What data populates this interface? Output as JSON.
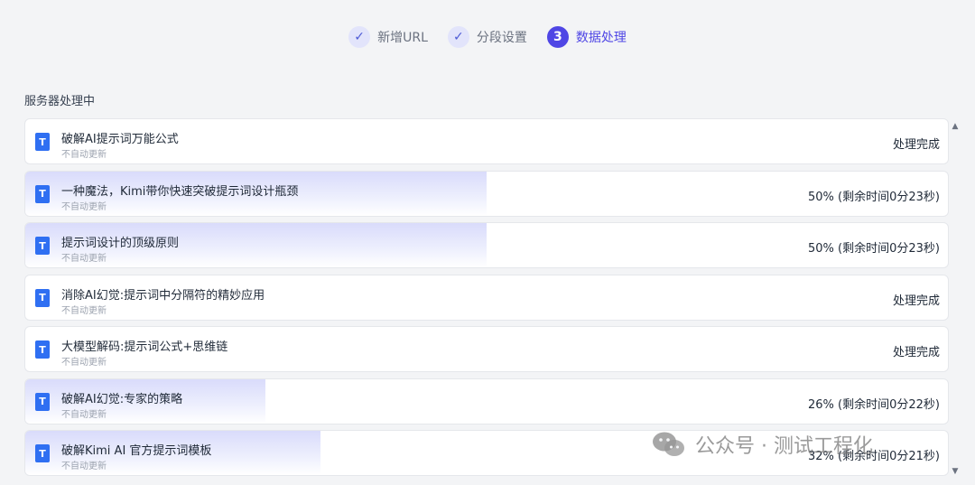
{
  "stepper": {
    "steps": [
      {
        "label": "新增URL",
        "status": "done",
        "marker": "✓"
      },
      {
        "label": "分段设置",
        "status": "done",
        "marker": "✓"
      },
      {
        "label": "数据处理",
        "status": "active",
        "marker": "3"
      }
    ]
  },
  "section": {
    "title": "服务器处理中"
  },
  "items": [
    {
      "title": "破解AI提示词万能公式",
      "subtitle": "不自动更新",
      "status": "处理完成",
      "progress": 1.0,
      "icon": "T"
    },
    {
      "title": "一种魔法，Kimi带你快速突破提示词设计瓶颈",
      "subtitle": "不自动更新",
      "status": "50% (剩余时间0分23秒)",
      "progress": 0.5,
      "icon": "T"
    },
    {
      "title": "提示词设计的顶级原则",
      "subtitle": "不自动更新",
      "status": "50% (剩余时间0分23秒)",
      "progress": 0.5,
      "icon": "T"
    },
    {
      "title": "消除AI幻觉:提示词中分隔符的精妙应用",
      "subtitle": "不自动更新",
      "status": "处理完成",
      "progress": 1.0,
      "icon": "T"
    },
    {
      "title": "大模型解码:提示词公式+思维链",
      "subtitle": "不自动更新",
      "status": "处理完成",
      "progress": 1.0,
      "icon": "T"
    },
    {
      "title": "破解AI幻觉:专家的策略",
      "subtitle": "不自动更新",
      "status": "26% (剩余时间0分22秒)",
      "progress": 0.26,
      "icon": "T"
    },
    {
      "title": "破解Kimi AI 官方提示词模板",
      "subtitle": "不自动更新",
      "status": "32% (剩余时间0分21秒)",
      "progress": 0.32,
      "icon": "T"
    }
  ],
  "scrollbar": {
    "up": "▲",
    "down": "▼"
  },
  "watermark": {
    "text": "公众号 · 测试工程化"
  }
}
